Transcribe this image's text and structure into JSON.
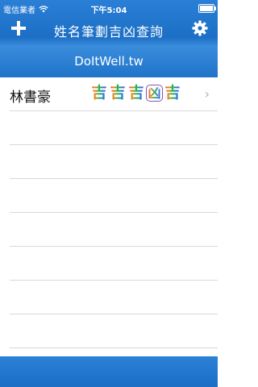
{
  "status": {
    "carrier": "電信業者",
    "time": "下午5:04",
    "battery_level_pct": 90
  },
  "navbar": {
    "title": "姓名筆劃吉凶查詢",
    "add_icon": "plus-icon",
    "settings_icon": "gear-icon"
  },
  "banner": {
    "text": "DoItWell.tw"
  },
  "list": {
    "items": [
      {
        "name": "林書豪",
        "fortunes": [
          "吉",
          "吉",
          "吉",
          "凶",
          "吉"
        ]
      }
    ],
    "empty_rows": 7
  },
  "colors": {
    "nav_blue": "#1c6fc5",
    "text": "#111111",
    "separator": "#d8d8d8",
    "chevron": "#b0b0b0"
  }
}
